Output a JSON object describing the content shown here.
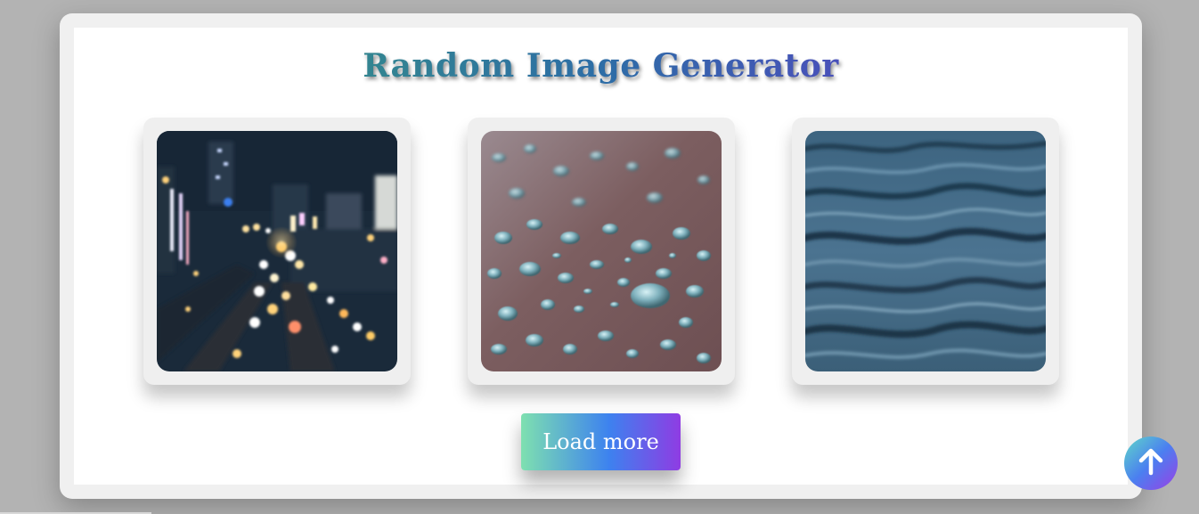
{
  "header": {
    "title": "Random Image Generator"
  },
  "gallery": {
    "images": [
      {
        "subject": "blurred night city traffic",
        "icon": "city-night-photo"
      },
      {
        "subject": "water droplets on surface",
        "icon": "water-droplets-photo"
      },
      {
        "subject": "rippling dark water",
        "icon": "water-waves-photo"
      }
    ]
  },
  "actions": {
    "load_more_label": "Load more",
    "scroll_top_icon": "arrow-up-icon"
  },
  "colors": {
    "gradient_start": "#7ee0b0",
    "gradient_mid": "#3d82ef",
    "gradient_end": "#8f3ce3",
    "page_background": "#b3b3b3",
    "card_background": "#f0f0f0"
  }
}
